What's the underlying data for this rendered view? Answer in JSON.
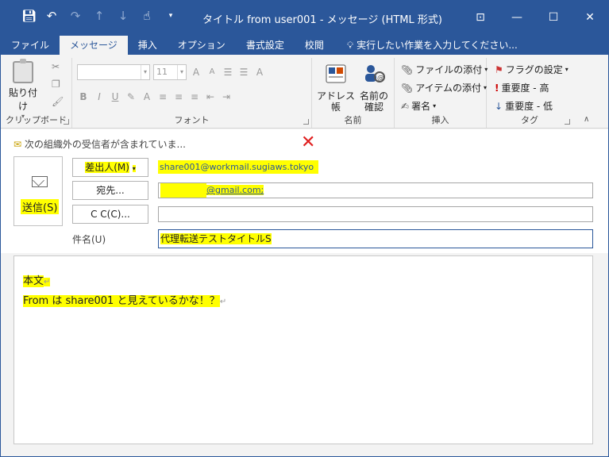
{
  "window": {
    "title": "タイトル from user001 - メッセージ (HTML 形式)",
    "qat_icons": [
      "save-icon",
      "undo-icon",
      "redo-icon",
      "up-icon",
      "down-icon",
      "touch-mode-icon",
      "customize-icon"
    ],
    "window_buttons": {
      "ribbon_display": "⊡",
      "minimize": "—",
      "maximize": "☐",
      "close": "✕"
    }
  },
  "tabs": [
    {
      "label": "ファイル",
      "active": false
    },
    {
      "label": "メッセージ",
      "active": true
    },
    {
      "label": "挿入",
      "active": false
    },
    {
      "label": "オプション",
      "active": false
    },
    {
      "label": "書式設定",
      "active": false
    },
    {
      "label": "校閲",
      "active": false
    }
  ],
  "tell_me": "実行したい作業を入力してください...",
  "ribbon": {
    "clipboard": {
      "paste_label": "貼り付け",
      "group_label": "クリップボード"
    },
    "font": {
      "size_value": "11",
      "group_label": "フォント",
      "bold": "B",
      "italic": "I",
      "underline": "U"
    },
    "names": {
      "address_book": "アドレス帳",
      "check_names_1": "名前の",
      "check_names_2": "確認",
      "group_label": "名前"
    },
    "include": {
      "attach_file": "ファイルの添付",
      "attach_item": "アイテムの添付",
      "signature": "署名",
      "group_label": "挿入"
    },
    "tags": {
      "follow_up": "フラグの設定",
      "high_importance": "重要度 - 高",
      "low_importance": "重要度 - 低",
      "group_label": "タグ"
    }
  },
  "infobar": {
    "text": "次の組織外の受信者が含まれていま..."
  },
  "compose": {
    "send_label": "送信(S)",
    "from_label": "差出人(M)",
    "from_value": "share001@workmail.sugiaws.tokyo",
    "to_label": "宛先...",
    "to_value": "@gmail.com;",
    "cc_label": "C C(C)...",
    "cc_value": "",
    "subject_label": "件名(U)",
    "subject_value": "代理転送テストタイトルS"
  },
  "body": {
    "line1": "本文",
    "line2": "From は share001 と見えているかな！？"
  }
}
